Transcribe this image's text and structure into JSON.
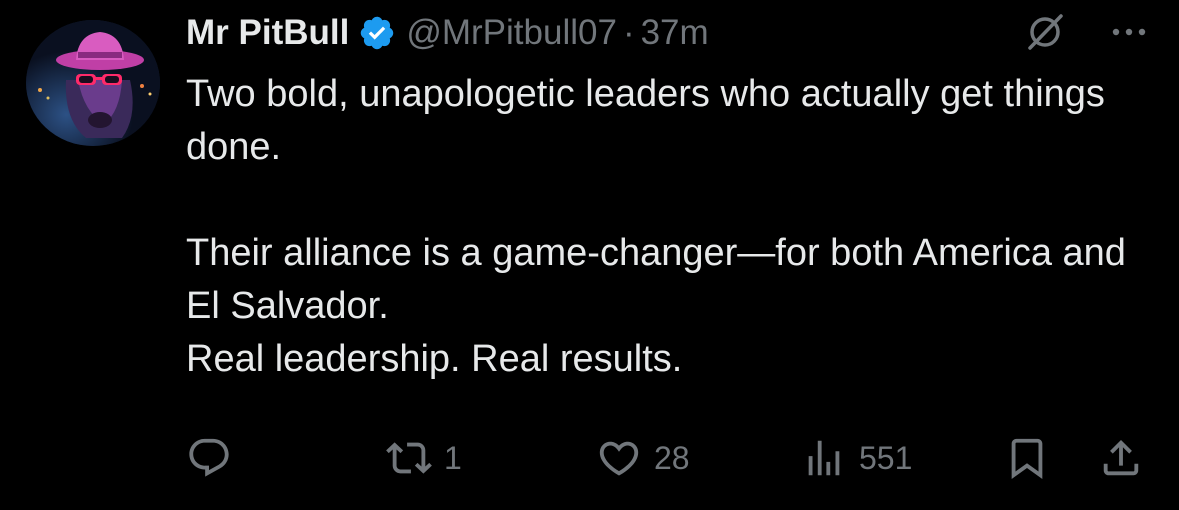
{
  "author": {
    "display_name": "Mr PitBull",
    "handle": "@MrPitbull07",
    "separator": "·",
    "time": "37m",
    "verified": true
  },
  "tweet": {
    "paragraph_1": "Two bold, unapologetic leaders who actually get things done.",
    "paragraph_2_line_1": "Their alliance is a game-changer—for both America and El Salvador.",
    "paragraph_2_line_2": "Real leadership. Real results."
  },
  "actions": {
    "reply_count": "",
    "repost_count": "1",
    "like_count": "28",
    "views_count": "551"
  },
  "icons": {
    "verified": "verified-badge-icon",
    "grok": "grok-icon",
    "more": "more-icon",
    "reply": "reply-icon",
    "repost": "repost-icon",
    "like": "heart-icon",
    "views": "views-icon",
    "bookmark": "bookmark-icon",
    "share": "share-icon"
  },
  "colors": {
    "background": "#000000",
    "text_primary": "#e7e9ea",
    "text_secondary": "#71767b",
    "verified_blue": "#1d9bf0"
  }
}
